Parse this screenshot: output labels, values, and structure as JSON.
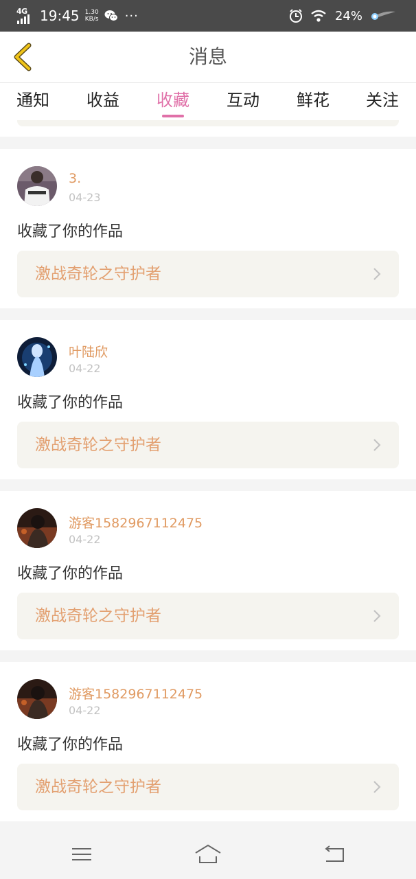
{
  "status_bar": {
    "network": "4G",
    "time": "19:45",
    "speed_value": "1.30",
    "speed_unit": "KB/s",
    "dots": "···",
    "battery": "24%"
  },
  "header": {
    "title": "消息",
    "back_icon": "chevron-left-icon",
    "accent": "#f0c419"
  },
  "tabs": {
    "items": [
      {
        "label": "通知"
      },
      {
        "label": "收益"
      },
      {
        "label": "收藏"
      },
      {
        "label": "互动"
      },
      {
        "label": "鲜花"
      },
      {
        "label": "关注"
      }
    ],
    "active": "收藏",
    "active_color": "#e070a8"
  },
  "messages": [
    {
      "username": "3.",
      "date": "04-23",
      "action": "收藏了你的作品",
      "work": "激战奇轮之守护者"
    },
    {
      "username": "叶陆欣",
      "date": "04-22",
      "action": "收藏了你的作品",
      "work": "激战奇轮之守护者"
    },
    {
      "username": "游客1582967112475",
      "date": "04-22",
      "action": "收藏了你的作品",
      "work": "激战奇轮之守护者"
    },
    {
      "username": "游客1582967112475",
      "date": "04-22",
      "action": "收藏了你的作品",
      "work": "激战奇轮之守护者"
    }
  ],
  "colors": {
    "username": "#e09a62",
    "work_title": "#e3a172",
    "work_box": "#f5f4ef"
  },
  "nav_icons": [
    "menu-icon",
    "home-icon",
    "back-arrow-icon"
  ]
}
